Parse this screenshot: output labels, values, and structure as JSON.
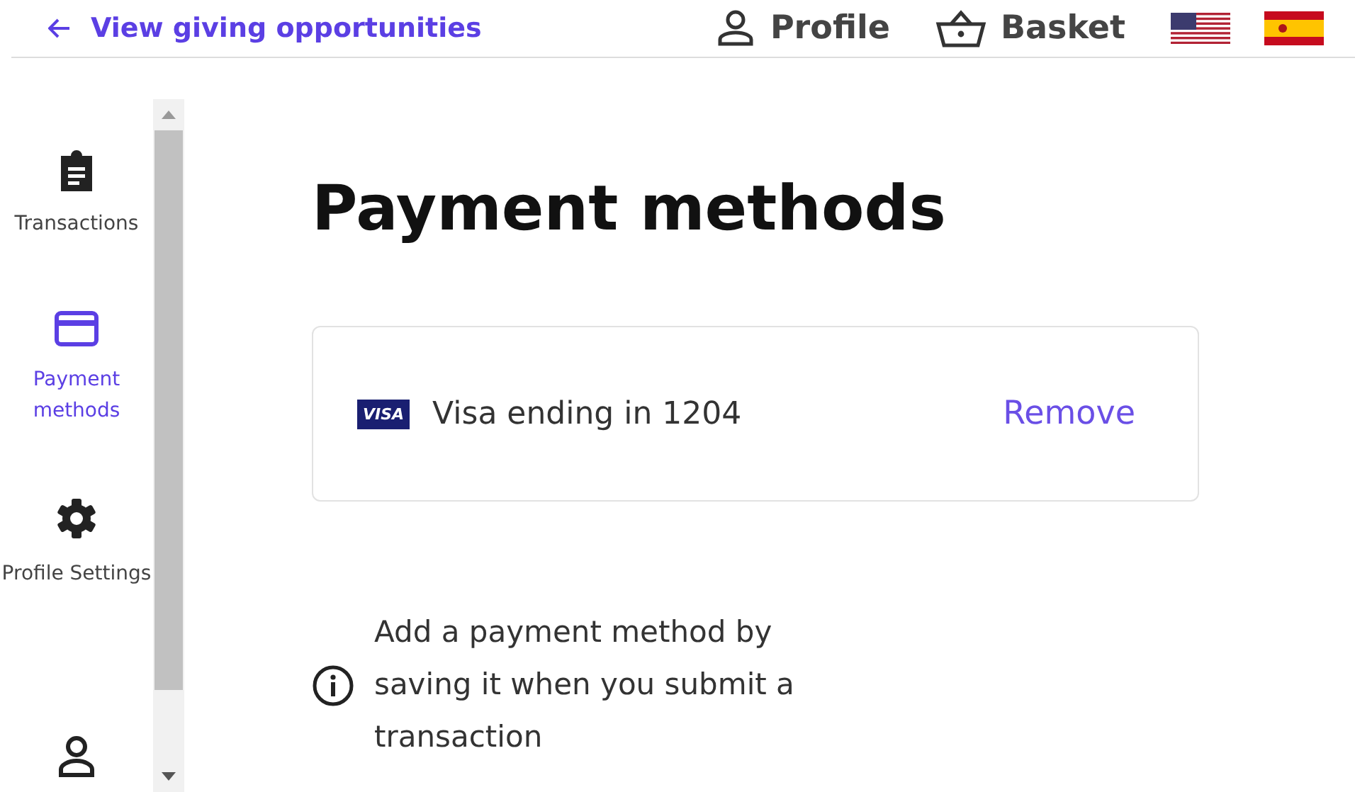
{
  "header": {
    "back_link": "View giving opportunities",
    "nav": [
      {
        "kind": "profile",
        "label": "Profile"
      },
      {
        "kind": "basket",
        "label": "Basket"
      }
    ],
    "languages": [
      {
        "kind": "us"
      },
      {
        "kind": "es"
      }
    ]
  },
  "sidebar": {
    "items": [
      {
        "kind": "clipboard",
        "label": "Transactions",
        "selected": false
      },
      {
        "kind": "card",
        "label": "Payment methods",
        "selected": true
      },
      {
        "kind": "gear",
        "label": "Profile Settings",
        "selected": false
      },
      {
        "kind": "person",
        "selected": false
      }
    ]
  },
  "page": {
    "title": "Payment methods",
    "cards": [
      {
        "brand": "VISA",
        "label": "Visa ending in 1204",
        "action": "Remove"
      }
    ],
    "info": "Add a payment method by saving it when you submit a transaction"
  }
}
